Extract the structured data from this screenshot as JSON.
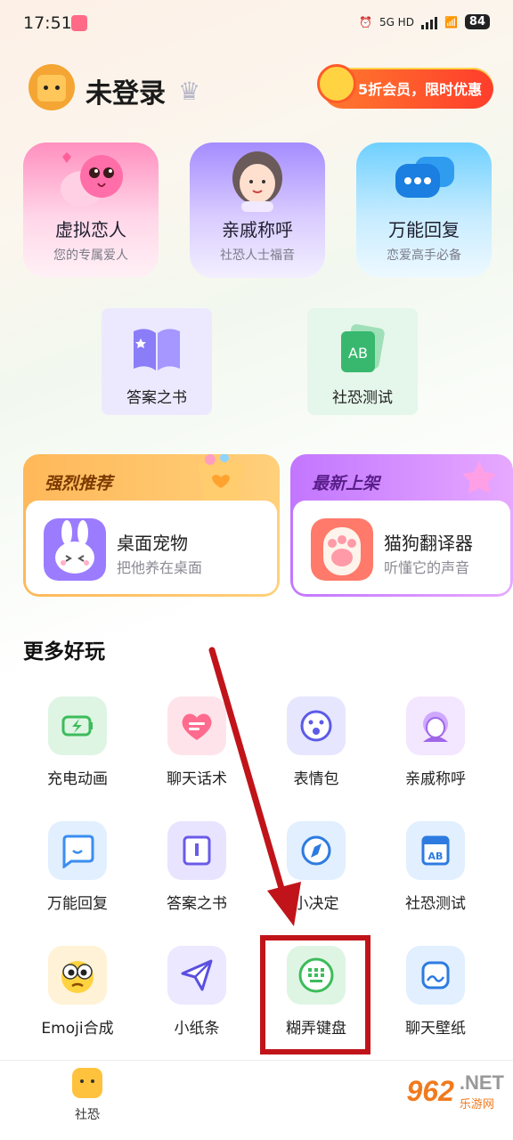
{
  "status": {
    "time": "17:51",
    "network": "5G HD",
    "battery": "84"
  },
  "header": {
    "user": "未登录",
    "promo": "5折会员，限时优惠"
  },
  "big_cards": [
    {
      "title": "虚拟恋人",
      "sub": "您的专属爱人"
    },
    {
      "title": "亲戚称呼",
      "sub": "社恐人士福音"
    },
    {
      "title": "万能回复",
      "sub": "恋爱高手必备"
    }
  ],
  "small_cards": [
    {
      "title": "答案之书"
    },
    {
      "title": "社恐测试",
      "badge": "AB"
    }
  ],
  "recommend": [
    {
      "tag": "强烈推荐",
      "name": "桌面宠物",
      "sub": "把他养在桌面"
    },
    {
      "tag": "最新上架",
      "name": "猫狗翻译器",
      "sub": "听懂它的声音"
    }
  ],
  "section_title": "更多好玩",
  "tools": [
    {
      "label": "充电动画"
    },
    {
      "label": "聊天话术"
    },
    {
      "label": "表情包"
    },
    {
      "label": "亲戚称呼"
    },
    {
      "label": "万能回复"
    },
    {
      "label": "答案之书"
    },
    {
      "label": "小决定"
    },
    {
      "label": "社恐测试",
      "badge": "AB"
    },
    {
      "label": "Emoji合成"
    },
    {
      "label": "小纸条"
    },
    {
      "label": "糊弄键盘"
    },
    {
      "label": "聊天壁纸"
    }
  ],
  "bottom_nav": {
    "home_label": "社恐"
  },
  "watermark": {
    "logo": "962",
    "net": ".NET",
    "sub": "乐游网"
  }
}
